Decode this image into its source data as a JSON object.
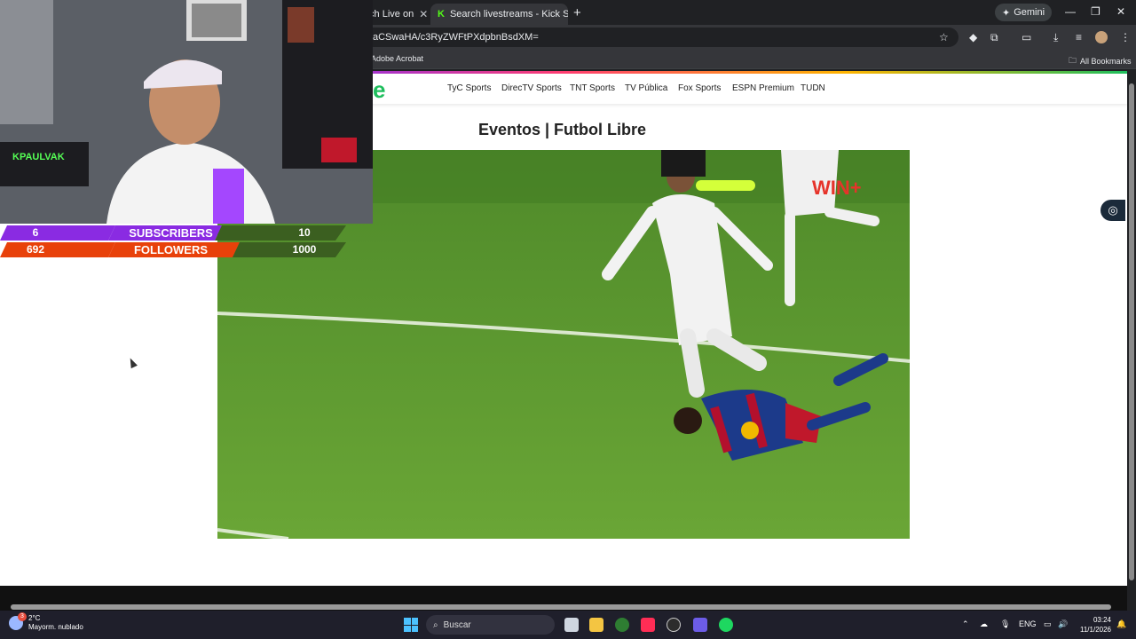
{
  "browser": {
    "tabs": [
      {
        "label": "tch Live on",
        "active": false
      },
      {
        "label": "Search livestreams - Kick Stream",
        "active": true
      }
    ],
    "new_tab": "+",
    "gemini_label": "Gemini",
    "url": "aCSwaHA/c3RyZWFtPXdpbnBsdXM=",
    "bookmarks": [
      {
        "label": "Adobe Acrobat"
      }
    ],
    "all_bookmarks": "All Bookmarks"
  },
  "site": {
    "logo_fragment": "e",
    "nav": [
      "TyC Sports",
      "DirecTV Sports",
      "TNT Sports",
      "TV Pública",
      "Fox Sports",
      "ESPN Premium",
      "TUDN"
    ],
    "heading": "Eventos | Futbol Libre",
    "video_watermark": "WIN+"
  },
  "stream_overlay": {
    "subscribers": {
      "current": "6",
      "label": "SUBSCRIBERS",
      "goal": "10"
    },
    "followers": {
      "current": "692",
      "label": "FOLLOWERS",
      "goal": "1000"
    },
    "neon_sign": "KPAULVAK"
  },
  "taskbar": {
    "weather_temp": "2°C",
    "weather_desc": "Mayorm. nublado",
    "weather_badge": "3",
    "search_placeholder": "Buscar",
    "language": "ENG",
    "time": "03:24",
    "date": "11/1/2026"
  },
  "colors": {
    "site_accent": "#1ebe5d",
    "subscribers_bar": "#8a2be2",
    "followers_bar": "#e8410a",
    "goal_bar": "#3b5f20"
  }
}
